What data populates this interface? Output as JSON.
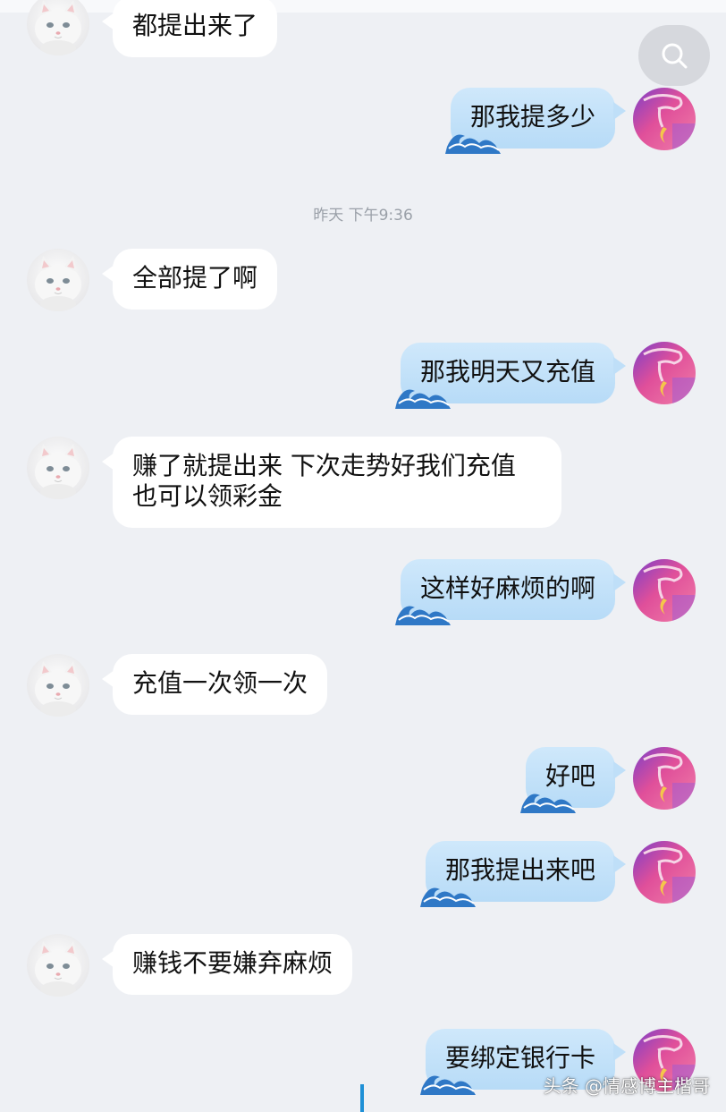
{
  "timestamp": "昨天 下午9:36",
  "watermark": "头条 @情感博主楷哥",
  "messages": [
    {
      "side": "in",
      "text": "都提出来了"
    },
    {
      "side": "out",
      "text": "那我提多少"
    },
    {
      "side": "in",
      "text": "全部提了啊"
    },
    {
      "side": "out",
      "text": "那我明天又充值"
    },
    {
      "side": "in",
      "text": "赚了就提出来 下次走势好我们充值 也可以领彩金"
    },
    {
      "side": "out",
      "text": "这样好麻烦的啊"
    },
    {
      "side": "in",
      "text": "充值一次领一次"
    },
    {
      "side": "out",
      "text": "好吧"
    },
    {
      "side": "out",
      "text": "那我提出来吧"
    },
    {
      "side": "in",
      "text": "赚钱不要嫌弃麻烦"
    },
    {
      "side": "out",
      "text": "要绑定银行卡"
    }
  ],
  "icons": {
    "search": "search-icon",
    "contact_avatar": "white-cat-avatar",
    "user_avatar": "pink-moon-hand-avatar"
  },
  "colors": {
    "background": "#eef0f4",
    "incoming_bubble": "#ffffff",
    "outgoing_bubble": "#c4e2f9",
    "timestamp_text": "#9aa0a8",
    "cursor": "#1e90d6"
  }
}
